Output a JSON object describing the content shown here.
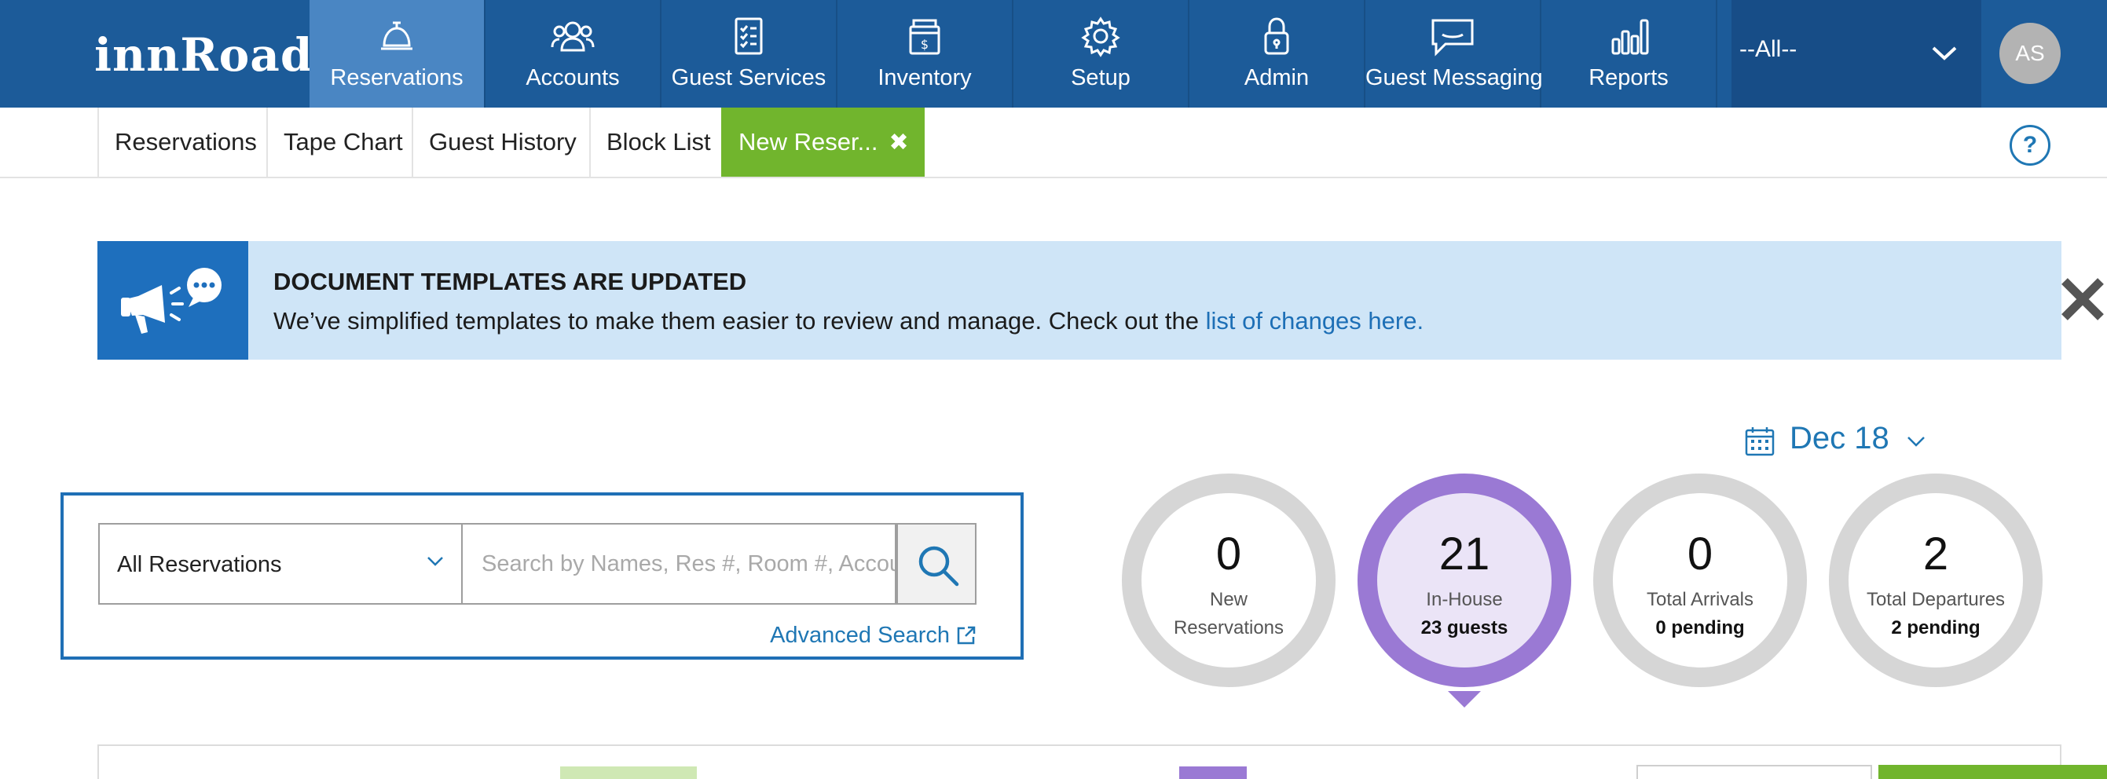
{
  "app": {
    "logo": "innRoad"
  },
  "nav": {
    "items": [
      {
        "label": "Reservations",
        "icon": "bell-icon",
        "active": true
      },
      {
        "label": "Accounts",
        "icon": "people-icon"
      },
      {
        "label": "Guest Services",
        "icon": "checklist-icon"
      },
      {
        "label": "Inventory",
        "icon": "cash-register-icon"
      },
      {
        "label": "Setup",
        "icon": "gear-icon"
      },
      {
        "label": "Admin",
        "icon": "lock-icon"
      },
      {
        "label": "Guest Messaging",
        "icon": "chat-bubble-icon"
      },
      {
        "label": "Reports",
        "icon": "bar-chart-icon"
      }
    ],
    "property_select": "--All--",
    "avatar_initials": "AS"
  },
  "subtabs": {
    "items": [
      {
        "label": "Reservations"
      },
      {
        "label": "Tape Chart"
      },
      {
        "label": "Guest History"
      },
      {
        "label": "Block List"
      },
      {
        "label": "New Reser...",
        "active": true,
        "closable": true
      }
    ],
    "close_glyph": "✖",
    "help_label": "?"
  },
  "banner": {
    "title": "DOCUMENT TEMPLATES ARE UPDATED",
    "body": "We’ve simplified templates to make them easier to review and manage. Check out the",
    "link": "list of changes here."
  },
  "date": {
    "label": "Dec 18"
  },
  "search": {
    "filter_value": "All Reservations",
    "placeholder": "Search by Names, Res #, Room #, Account",
    "advanced_label": "Advanced Search"
  },
  "stats": [
    {
      "value": "0",
      "label": "New",
      "label2": "Reservations"
    },
    {
      "value": "21",
      "label": "In-House",
      "sub": "23 guests",
      "active": true
    },
    {
      "value": "0",
      "label": "Total Arrivals",
      "sub": "0 pending"
    },
    {
      "value": "2",
      "label": "Total Departures",
      "sub": "2 pending"
    }
  ],
  "colors": {
    "nav_bg": "#1c5b99",
    "nav_active": "#4a86c3",
    "accent_blue": "#1f77b4",
    "tab_active_green": "#71b52d",
    "banner_bg": "#cfe5f7",
    "stat_active": "#9a79d4"
  }
}
